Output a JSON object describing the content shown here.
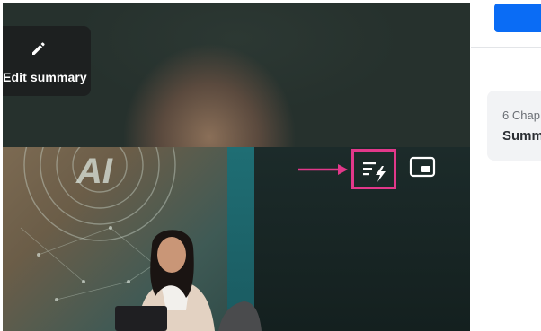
{
  "video_panel": {
    "edit_summary_label": "Edit summary",
    "icons": {
      "edit": "pencil-icon",
      "chapters_ai": "list-lightning-icon",
      "pip": "picture-in-picture-icon",
      "pointer": "arrow-right-icon"
    },
    "highlight_color": "#e2388a",
    "artwork_text": "AI"
  },
  "side_panel": {
    "primary_button_color": "#0a6cf5",
    "chapter_card": {
      "count_text": "6 Chap",
      "title_text": "Summ"
    }
  }
}
